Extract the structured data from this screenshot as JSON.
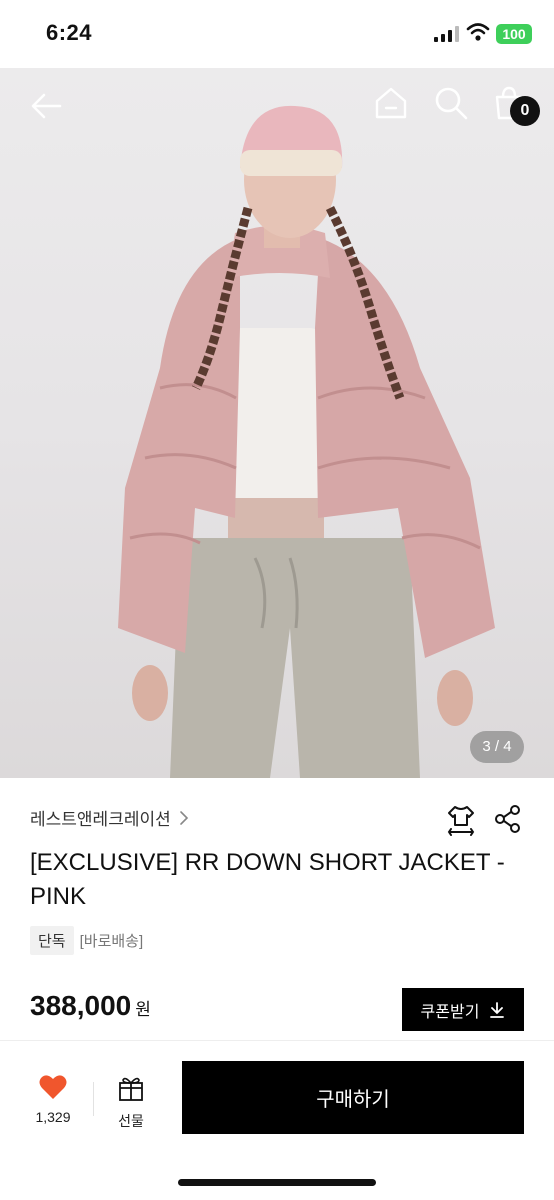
{
  "status_bar": {
    "time": "6:24",
    "battery": "100"
  },
  "header": {
    "cart_count": "0"
  },
  "gallery": {
    "pager": "3 / 4"
  },
  "product": {
    "brand": "레스트앤레크레이션",
    "title": "[EXCLUSIVE] RR DOWN SHORT JACKET - PINK",
    "tag_exclusive": "단독",
    "tag_delivery": "[바로배송]",
    "price": "388,000",
    "currency": "원",
    "coupon_label": "쿠폰받기"
  },
  "bottom_bar": {
    "like_count": "1,329",
    "gift_label": "선물",
    "buy_label": "구매하기"
  },
  "colors": {
    "accent": "#000000",
    "heart": "#f0562d",
    "battery": "#3ecf5a"
  },
  "icons": [
    "back-arrow-icon",
    "home-icon",
    "search-icon",
    "cart-icon",
    "size-guide-icon",
    "share-icon",
    "chevron-right-icon",
    "download-icon",
    "heart-icon",
    "gift-icon"
  ]
}
